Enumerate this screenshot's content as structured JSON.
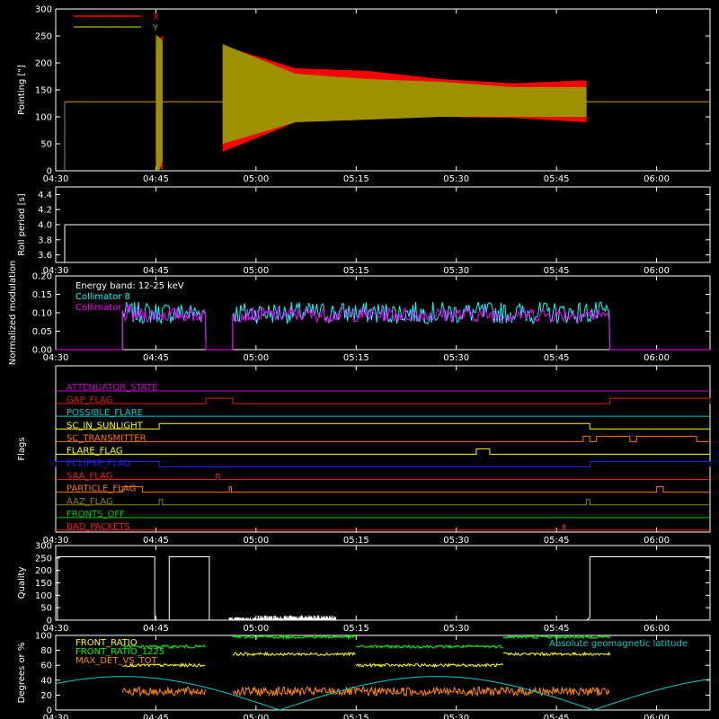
{
  "time_ticks": [
    "04:30",
    "04:45",
    "05:00",
    "05:15",
    "05:30",
    "05:45",
    "06:00"
  ],
  "chart_data": [
    {
      "type": "line",
      "ylabel": "Pointing [\"]",
      "yticks": [
        "0",
        "50",
        "100",
        "150",
        "200",
        "250",
        "300"
      ],
      "ylim": [
        0,
        300
      ],
      "legend": [
        {
          "name": "X",
          "color": "#ff0000"
        },
        {
          "name": "Y",
          "color": "#999900"
        }
      ],
      "series": [
        {
          "name": "X",
          "color": "#ff0000",
          "baseline": 128,
          "segments": [
            {
              "t": [
                "04:45:00",
                "04:46:00"
              ],
              "y": [
                [
                  5,
                  228
                ],
                [
                  10,
                  245
                ],
                [
                  0,
                  250
                ]
              ]
            },
            {
              "t": [
                "04:55:00",
                "05:49:30"
              ],
              "y": [
                [
                  35,
                  232
                ],
                [
                  90,
                  190
                ],
                [
                  95,
                  185
                ],
                [
                  100,
                  170
                ],
                [
                  98,
                  162
                ],
                [
                  90,
                  168
                ]
              ]
            }
          ]
        },
        {
          "name": "Y",
          "color": "#999900",
          "baseline": 128,
          "segments": [
            {
              "t": [
                "04:45:00",
                "04:46:00"
              ],
              "y": [
                [
                  0,
                  252
                ],
                [
                  0,
                  248
                ],
                [
                  20,
                  240
                ]
              ]
            },
            {
              "t": [
                "04:55:00",
                "05:49:30"
              ],
              "y": [
                [
                  50,
                  235
                ],
                [
                  90,
                  180
                ],
                [
                  95,
                  170
                ],
                [
                  100,
                  165
                ],
                [
                  100,
                  155
                ],
                [
                  100,
                  155
                ]
              ]
            }
          ]
        }
      ]
    },
    {
      "type": "line",
      "ylabel": "Roll period [s]",
      "yticks": [
        "3.6",
        "3.8",
        "4.0",
        "4.2",
        "4.4"
      ],
      "ylim": [
        3.5,
        4.5
      ],
      "series": [
        {
          "name": "Roll period",
          "color": "#ffffff",
          "value": 4.0,
          "start": "04:30:00",
          "end": "06:08:00"
        }
      ]
    },
    {
      "type": "line",
      "ylabel": "Normalized modulation",
      "yticks": [
        "0.00",
        "0.05",
        "0.10",
        "0.15",
        "0.20"
      ],
      "ylim": [
        0,
        0.2
      ],
      "annotation": "Energy band: 12-25 keV",
      "legend": [
        {
          "name": "Collimator 8",
          "color": "#00ffff"
        },
        {
          "name": "Collimator 9",
          "color": "#ff00ff"
        }
      ],
      "series": [
        {
          "name": "Collimator 8",
          "color": "#00ffff",
          "mean": 0.1,
          "spread": 0.03,
          "segments": [
            [
              "04:40:00",
              "04:52:30"
            ],
            [
              "04:56:30",
              "05:53:00"
            ]
          ]
        },
        {
          "name": "Collimator 9",
          "color": "#ff00ff",
          "mean": 0.095,
          "spread": 0.02,
          "segments": [
            [
              "04:40:00",
              "04:52:30"
            ],
            [
              "04:56:30",
              "05:53:00"
            ]
          ]
        }
      ]
    },
    {
      "type": "line",
      "ylabel": "Flags",
      "flags": [
        {
          "name": "ATTENUATOR_STATE",
          "color": "#cc00cc",
          "on": []
        },
        {
          "name": "GAP_FLAG",
          "color": "#dd2200",
          "on": [
            [
              "04:52:30",
              "04:56:30"
            ],
            [
              "05:53:00",
              "06:08:00"
            ]
          ]
        },
        {
          "name": "POSSIBLE_FLARE",
          "color": "#00cccc",
          "on": []
        },
        {
          "name": "SC_IN_SUNLIGHT",
          "color": "#ffff00",
          "on": [
            [
              "04:45:30",
              "05:50:00"
            ]
          ]
        },
        {
          "name": "SC_TRANSMITTER",
          "color": "#ff7700",
          "on": [
            [
              "05:49:00",
              "05:50:00"
            ],
            [
              "05:51:00",
              "05:56:00"
            ],
            [
              "05:57:00",
              "06:06:00"
            ]
          ]
        },
        {
          "name": "FLARE_FLAG",
          "color": "#ffff00",
          "on": [
            [
              "05:33:00",
              "05:35:00"
            ]
          ]
        },
        {
          "name": "ECLIPSE_FLAG",
          "color": "#2222ff",
          "on": [
            [
              "04:30:00",
              "04:45:30"
            ],
            [
              "05:50:00",
              "06:08:00"
            ]
          ]
        },
        {
          "name": "SAA_FLAG",
          "color": "#ee2222",
          "on": [
            [
              "04:54:00",
              "04:54:30"
            ]
          ]
        },
        {
          "name": "PARTICLE_FLAG",
          "color": "#ff7700",
          "on": [
            [
              "04:40:00",
              "04:43:00"
            ],
            [
              "04:56:00",
              "04:56:20"
            ],
            [
              "06:00:00",
              "06:01:00"
            ]
          ]
        },
        {
          "name": "AAZ_FLAG",
          "color": "#888800",
          "on": [
            [
              "04:45:30",
              "04:46:00"
            ],
            [
              "05:49:30",
              "05:50:00"
            ]
          ]
        },
        {
          "name": "FRONTS_OFF",
          "color": "#00cc00",
          "on": []
        },
        {
          "name": "BAD_PACKETS",
          "color": "#ee2222",
          "on": [
            [
              "05:46:00",
              "05:46:15"
            ]
          ]
        }
      ]
    },
    {
      "type": "line",
      "ylabel": "Quality",
      "yticks": [
        "0",
        "50",
        "100",
        "150",
        "200",
        "250",
        "300"
      ],
      "ylim": [
        0,
        300
      ],
      "series": [
        {
          "name": "Quality",
          "color": "#ffffff",
          "points": [
            [
              "04:30:00",
              0
            ],
            [
              "04:30:15",
              0
            ],
            [
              "04:30:15",
              255
            ],
            [
              "04:44:50",
              255
            ],
            [
              "04:44:50",
              0
            ],
            [
              "04:47:00",
              0
            ],
            [
              "04:47:00",
              255
            ],
            [
              "04:53:00",
              255
            ],
            [
              "04:53:00",
              0
            ],
            [
              "05:49:30",
              0
            ],
            [
              "05:50:00",
              10
            ],
            [
              "05:50:00",
              255
            ],
            [
              "06:08:00",
              255
            ]
          ],
          "noise": {
            "start": "04:56:00",
            "end": "05:12:00",
            "max": 20
          }
        }
      ]
    },
    {
      "type": "line",
      "ylabel": "Degrees or %",
      "yticks": [
        "0",
        "20",
        "40",
        "60",
        "80",
        "100"
      ],
      "ylim": [
        0,
        100
      ],
      "legend": [
        {
          "name": "FRONT_RATIO",
          "color": "#ffff00"
        },
        {
          "name": "FRONT_RATIO_1225",
          "color": "#00ff00"
        },
        {
          "name": "MAX_DET_VS_TOT",
          "color": "#ff8800"
        }
      ],
      "annotation": "Absolute geomagnetic latitude",
      "annotation_color": "#00cccc",
      "series": [
        {
          "name": "FRONT_RATIO",
          "color": "#ffff00",
          "segments": [
            {
              "t": [
                "04:40:00",
                "04:52:30"
              ],
              "y": 60
            },
            {
              "t": [
                "04:56:30",
                "05:15:00"
              ],
              "y": 75
            },
            {
              "t": [
                "05:15:00",
                "05:37:00"
              ],
              "y": 60
            },
            {
              "t": [
                "05:37:00",
                "05:53:00"
              ],
              "y": 75
            }
          ]
        },
        {
          "name": "FRONT_RATIO_1225",
          "color": "#00ff00",
          "segments": [
            {
              "t": [
                "04:40:00",
                "04:52:30"
              ],
              "y": 85
            },
            {
              "t": [
                "04:56:30",
                "05:15:00"
              ],
              "y": 98
            },
            {
              "t": [
                "05:15:00",
                "05:37:00"
              ],
              "y": 85
            },
            {
              "t": [
                "05:37:00",
                "05:53:00"
              ],
              "y": 98
            }
          ]
        },
        {
          "name": "MAX_DET_VS_TOT",
          "color": "#ff8800",
          "segments": [
            {
              "t": [
                "04:40:00",
                "04:52:30"
              ],
              "y": 25
            },
            {
              "t": [
                "04:56:30",
                "05:53:00"
              ],
              "y": 25
            }
          ]
        },
        {
          "name": "Absolute geomagnetic latitude",
          "color": "#00cccc",
          "wave": {
            "amplitude": 45,
            "period_min": 47,
            "phase_min": 0
          }
        }
      ]
    }
  ]
}
